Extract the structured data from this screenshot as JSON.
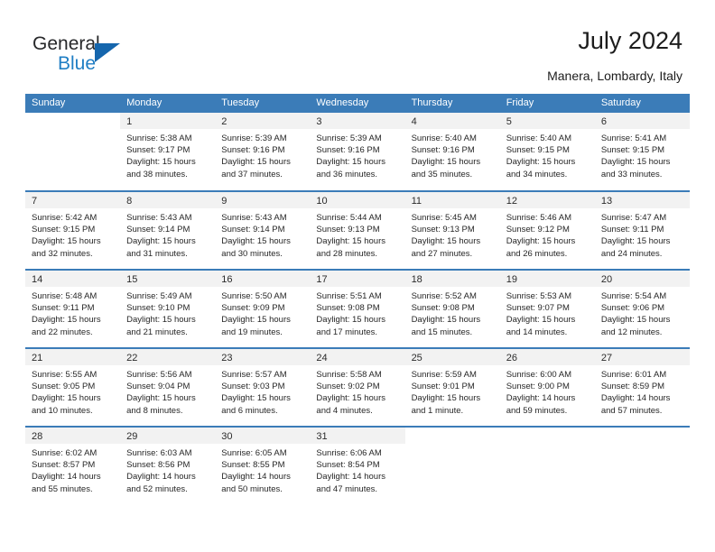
{
  "brand": {
    "name_top": "General",
    "name_bottom": "Blue",
    "triangle_color": "#1566ad",
    "blue_text_color": "#1f7ec4"
  },
  "header": {
    "title": "July 2024",
    "subtitle": "Manera, Lombardy, Italy"
  },
  "theme": {
    "header_blue": "#3b7cb8",
    "daynum_band": "#f2f2f2",
    "text": "#262626"
  },
  "weekday_headers": [
    "Sunday",
    "Monday",
    "Tuesday",
    "Wednesday",
    "Thursday",
    "Friday",
    "Saturday"
  ],
  "weeks": [
    [
      {
        "day": "",
        "lines": []
      },
      {
        "day": "1",
        "lines": [
          "Sunrise: 5:38 AM",
          "Sunset: 9:17 PM",
          "Daylight: 15 hours",
          "and 38 minutes."
        ]
      },
      {
        "day": "2",
        "lines": [
          "Sunrise: 5:39 AM",
          "Sunset: 9:16 PM",
          "Daylight: 15 hours",
          "and 37 minutes."
        ]
      },
      {
        "day": "3",
        "lines": [
          "Sunrise: 5:39 AM",
          "Sunset: 9:16 PM",
          "Daylight: 15 hours",
          "and 36 minutes."
        ]
      },
      {
        "day": "4",
        "lines": [
          "Sunrise: 5:40 AM",
          "Sunset: 9:16 PM",
          "Daylight: 15 hours",
          "and 35 minutes."
        ]
      },
      {
        "day": "5",
        "lines": [
          "Sunrise: 5:40 AM",
          "Sunset: 9:15 PM",
          "Daylight: 15 hours",
          "and 34 minutes."
        ]
      },
      {
        "day": "6",
        "lines": [
          "Sunrise: 5:41 AM",
          "Sunset: 9:15 PM",
          "Daylight: 15 hours",
          "and 33 minutes."
        ]
      }
    ],
    [
      {
        "day": "7",
        "lines": [
          "Sunrise: 5:42 AM",
          "Sunset: 9:15 PM",
          "Daylight: 15 hours",
          "and 32 minutes."
        ]
      },
      {
        "day": "8",
        "lines": [
          "Sunrise: 5:43 AM",
          "Sunset: 9:14 PM",
          "Daylight: 15 hours",
          "and 31 minutes."
        ]
      },
      {
        "day": "9",
        "lines": [
          "Sunrise: 5:43 AM",
          "Sunset: 9:14 PM",
          "Daylight: 15 hours",
          "and 30 minutes."
        ]
      },
      {
        "day": "10",
        "lines": [
          "Sunrise: 5:44 AM",
          "Sunset: 9:13 PM",
          "Daylight: 15 hours",
          "and 28 minutes."
        ]
      },
      {
        "day": "11",
        "lines": [
          "Sunrise: 5:45 AM",
          "Sunset: 9:13 PM",
          "Daylight: 15 hours",
          "and 27 minutes."
        ]
      },
      {
        "day": "12",
        "lines": [
          "Sunrise: 5:46 AM",
          "Sunset: 9:12 PM",
          "Daylight: 15 hours",
          "and 26 minutes."
        ]
      },
      {
        "day": "13",
        "lines": [
          "Sunrise: 5:47 AM",
          "Sunset: 9:11 PM",
          "Daylight: 15 hours",
          "and 24 minutes."
        ]
      }
    ],
    [
      {
        "day": "14",
        "lines": [
          "Sunrise: 5:48 AM",
          "Sunset: 9:11 PM",
          "Daylight: 15 hours",
          "and 22 minutes."
        ]
      },
      {
        "day": "15",
        "lines": [
          "Sunrise: 5:49 AM",
          "Sunset: 9:10 PM",
          "Daylight: 15 hours",
          "and 21 minutes."
        ]
      },
      {
        "day": "16",
        "lines": [
          "Sunrise: 5:50 AM",
          "Sunset: 9:09 PM",
          "Daylight: 15 hours",
          "and 19 minutes."
        ]
      },
      {
        "day": "17",
        "lines": [
          "Sunrise: 5:51 AM",
          "Sunset: 9:08 PM",
          "Daylight: 15 hours",
          "and 17 minutes."
        ]
      },
      {
        "day": "18",
        "lines": [
          "Sunrise: 5:52 AM",
          "Sunset: 9:08 PM",
          "Daylight: 15 hours",
          "and 15 minutes."
        ]
      },
      {
        "day": "19",
        "lines": [
          "Sunrise: 5:53 AM",
          "Sunset: 9:07 PM",
          "Daylight: 15 hours",
          "and 14 minutes."
        ]
      },
      {
        "day": "20",
        "lines": [
          "Sunrise: 5:54 AM",
          "Sunset: 9:06 PM",
          "Daylight: 15 hours",
          "and 12 minutes."
        ]
      }
    ],
    [
      {
        "day": "21",
        "lines": [
          "Sunrise: 5:55 AM",
          "Sunset: 9:05 PM",
          "Daylight: 15 hours",
          "and 10 minutes."
        ]
      },
      {
        "day": "22",
        "lines": [
          "Sunrise: 5:56 AM",
          "Sunset: 9:04 PM",
          "Daylight: 15 hours",
          "and 8 minutes."
        ]
      },
      {
        "day": "23",
        "lines": [
          "Sunrise: 5:57 AM",
          "Sunset: 9:03 PM",
          "Daylight: 15 hours",
          "and 6 minutes."
        ]
      },
      {
        "day": "24",
        "lines": [
          "Sunrise: 5:58 AM",
          "Sunset: 9:02 PM",
          "Daylight: 15 hours",
          "and 4 minutes."
        ]
      },
      {
        "day": "25",
        "lines": [
          "Sunrise: 5:59 AM",
          "Sunset: 9:01 PM",
          "Daylight: 15 hours",
          "and 1 minute."
        ]
      },
      {
        "day": "26",
        "lines": [
          "Sunrise: 6:00 AM",
          "Sunset: 9:00 PM",
          "Daylight: 14 hours",
          "and 59 minutes."
        ]
      },
      {
        "day": "27",
        "lines": [
          "Sunrise: 6:01 AM",
          "Sunset: 8:59 PM",
          "Daylight: 14 hours",
          "and 57 minutes."
        ]
      }
    ],
    [
      {
        "day": "28",
        "lines": [
          "Sunrise: 6:02 AM",
          "Sunset: 8:57 PM",
          "Daylight: 14 hours",
          "and 55 minutes."
        ]
      },
      {
        "day": "29",
        "lines": [
          "Sunrise: 6:03 AM",
          "Sunset: 8:56 PM",
          "Daylight: 14 hours",
          "and 52 minutes."
        ]
      },
      {
        "day": "30",
        "lines": [
          "Sunrise: 6:05 AM",
          "Sunset: 8:55 PM",
          "Daylight: 14 hours",
          "and 50 minutes."
        ]
      },
      {
        "day": "31",
        "lines": [
          "Sunrise: 6:06 AM",
          "Sunset: 8:54 PM",
          "Daylight: 14 hours",
          "and 47 minutes."
        ]
      },
      {
        "day": "",
        "lines": []
      },
      {
        "day": "",
        "lines": []
      },
      {
        "day": "",
        "lines": []
      }
    ]
  ]
}
